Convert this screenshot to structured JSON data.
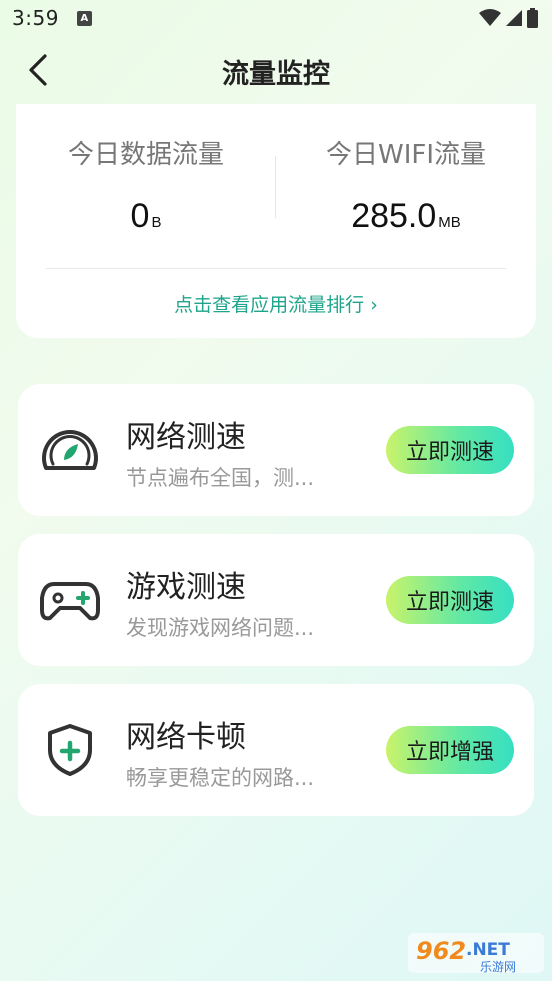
{
  "status_bar": {
    "time": "3:59",
    "notification_glyph": "A"
  },
  "nav": {
    "title": "流量监控"
  },
  "traffic": {
    "mobile_label": "今日数据流量",
    "mobile_value": "0",
    "mobile_unit": "B",
    "wifi_label": "今日WIFI流量",
    "wifi_value": "285.0",
    "wifi_unit": "MB",
    "ranking_link": "点击查看应用流量排行 ›"
  },
  "features": [
    {
      "title": "网络测速",
      "desc": "节点遍布全国，测...",
      "button": "立即测速",
      "icon": "speedometer-icon"
    },
    {
      "title": "游戏测速",
      "desc": "发现游戏网络问题...",
      "button": "立即测速",
      "icon": "gamepad-icon"
    },
    {
      "title": "网络卡顿",
      "desc": "畅享更稳定的网路...",
      "button": "立即增强",
      "icon": "shield-plus-icon"
    }
  ],
  "watermark": {
    "brand": "962.NET",
    "sub": "乐游网"
  },
  "colors": {
    "accent": "#1fa58c",
    "button_start": "#c9f36a",
    "button_end": "#36dfc2",
    "icon_green": "#22a56e"
  }
}
